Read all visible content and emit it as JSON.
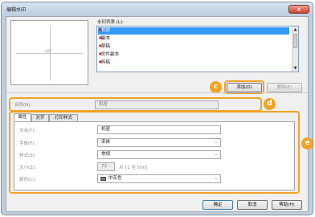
{
  "window": {
    "title": "编辑水印",
    "close_glyph": "x"
  },
  "preview": {
    "watermark_text": "机密"
  },
  "watermark_list": {
    "label": "水印列表 (L):",
    "items": [
      {
        "label": "机密",
        "selected": true
      },
      {
        "label": "副本",
        "selected": false
      },
      {
        "label": "草稿",
        "selected": false
      },
      {
        "label": "文件副本",
        "selected": false
      },
      {
        "label": "传稿",
        "selected": false
      }
    ]
  },
  "buttons": {
    "add": "添加(D)",
    "delete": "删除(E)",
    "ok": "确定",
    "cancel": "取消",
    "help": "帮助(H)"
  },
  "name_field": {
    "label": "名称(N):",
    "value": "机密"
  },
  "tabs": [
    {
      "label": "属性",
      "active": true
    },
    {
      "label": "对齐",
      "active": false
    },
    {
      "label": "打印样式",
      "active": false
    }
  ],
  "properties": {
    "text": {
      "label": "文本(T):",
      "value": "机密"
    },
    "font": {
      "label": "字体(F):",
      "value": "宋体"
    },
    "style": {
      "label": "样式(S):",
      "value": "常规"
    },
    "size": {
      "label": "大小(Z):",
      "value": "72",
      "unit": "点",
      "range": "[1 至 500]"
    },
    "color": {
      "label": "颜色(C):",
      "value": "中灰色",
      "swatch": "#7a7a7a"
    }
  },
  "callouts": {
    "c": "c",
    "d": "d",
    "e": "e"
  },
  "colors": {
    "accent": "#f3a323",
    "selection": "#3399ff",
    "titlebar": "#bccde0"
  },
  "icons": {
    "list_marker": "red-square-icon",
    "dropdown": "chevron-down-icon",
    "close": "close-icon"
  }
}
